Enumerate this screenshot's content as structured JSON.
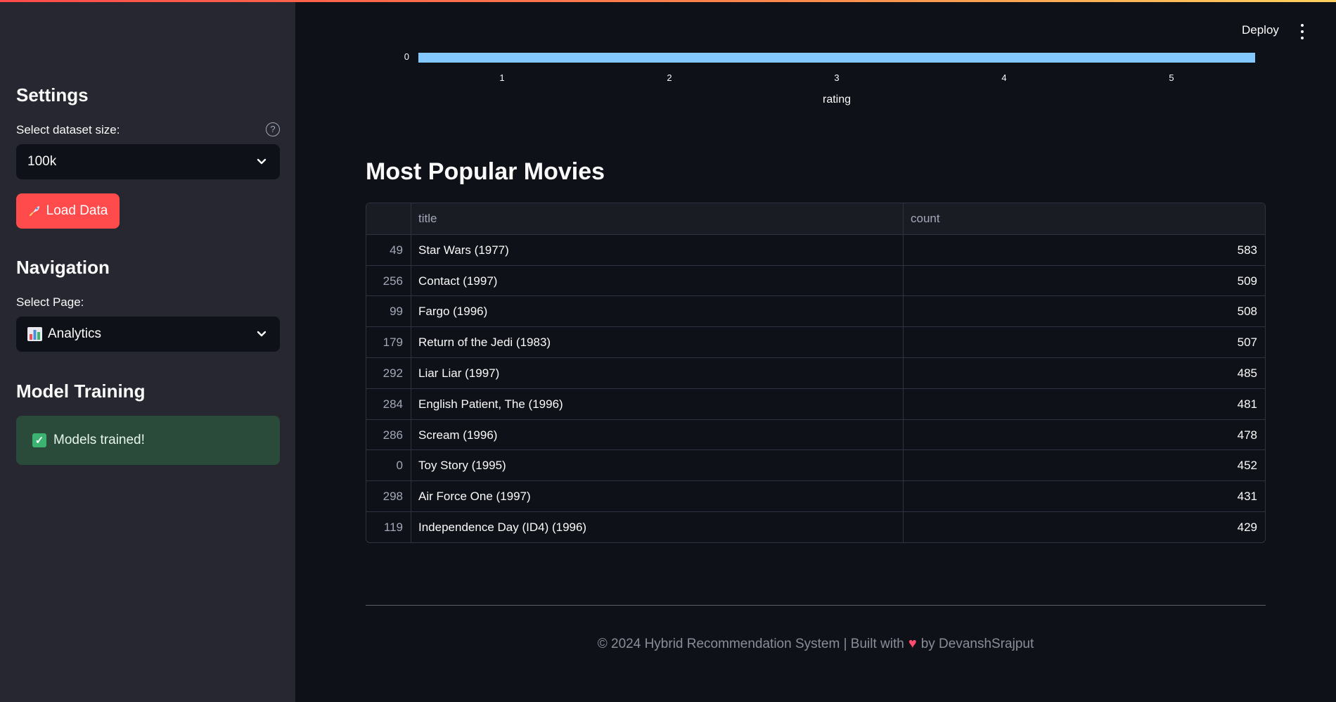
{
  "sidebar": {
    "settings_heading": "Settings",
    "dataset_label": "Select dataset size:",
    "dataset_value": "100k",
    "load_button": "Load Data",
    "load_icon": "rocket-icon",
    "navigation_heading": "Navigation",
    "page_label": "Select Page:",
    "page_value": "Analytics",
    "page_icon": "bar-chart-icon",
    "training_heading": "Model Training",
    "success_message": "Models trained!"
  },
  "header": {
    "deploy_label": "Deploy",
    "menu_icon": "kebab-menu-icon"
  },
  "chart_data": {
    "type": "bar",
    "x": [
      0.5,
      5.5
    ],
    "bar_range": [
      0.5,
      5.5
    ],
    "xticks": [
      "1",
      "2",
      "3",
      "4",
      "5"
    ],
    "ytick_visible": "0",
    "xlabel": "rating",
    "ylabel": "",
    "color": "#83c9ff"
  },
  "main": {
    "section_title": "Most Popular Movies",
    "table": {
      "columns": [
        "",
        "title",
        "count"
      ],
      "rows": [
        {
          "index": "49",
          "title": "Star Wars (1977)",
          "count": "583"
        },
        {
          "index": "256",
          "title": "Contact (1997)",
          "count": "509"
        },
        {
          "index": "99",
          "title": "Fargo (1996)",
          "count": "508"
        },
        {
          "index": "179",
          "title": "Return of the Jedi (1983)",
          "count": "507"
        },
        {
          "index": "292",
          "title": "Liar Liar (1997)",
          "count": "485"
        },
        {
          "index": "284",
          "title": "English Patient, The (1996)",
          "count": "481"
        },
        {
          "index": "286",
          "title": "Scream (1996)",
          "count": "478"
        },
        {
          "index": "0",
          "title": "Toy Story (1995)",
          "count": "452"
        },
        {
          "index": "298",
          "title": "Air Force One (1997)",
          "count": "431"
        },
        {
          "index": "119",
          "title": "Independence Day (ID4) (1996)",
          "count": "429"
        }
      ]
    }
  },
  "footer": {
    "text_before": "© 2024 Hybrid Recommendation System | Built with",
    "text_after": "by DevanshSrajput",
    "heart_icon": "heart-icon"
  },
  "colors": {
    "accent": "#ff4b4b",
    "sidebar_bg": "#262730",
    "main_bg": "#0e1117",
    "success_bg": "#2b4b3a",
    "bar": "#83c9ff"
  }
}
